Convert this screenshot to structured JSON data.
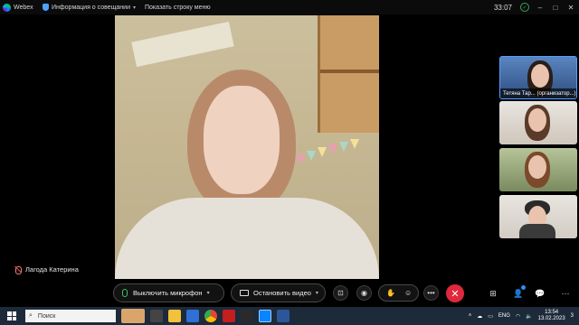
{
  "titlebar": {
    "app_name": "Webex",
    "meeting_info": "Информация о совещании",
    "show_menu": "Показать строку меню",
    "time": "33:07"
  },
  "main_participant": {
    "name": "Лагода Катерина"
  },
  "participants": [
    {
      "name": "Тетяна Тар... (организатор...)",
      "active": true
    },
    {
      "name": "",
      "active": false
    },
    {
      "name": "",
      "active": false
    },
    {
      "name": "",
      "active": false
    }
  ],
  "controls": {
    "mute_label": "Выключить микрофон",
    "video_label": "Остановить видео"
  },
  "taskbar": {
    "search_placeholder": "Поиск",
    "language": "ENG",
    "clock_time": "13:54",
    "clock_date": "13.02.2023",
    "notification_count": "3"
  },
  "colors": {
    "accent": "#2e8cff",
    "leave": "#e0283c",
    "mic_on": "#3fc26b"
  }
}
